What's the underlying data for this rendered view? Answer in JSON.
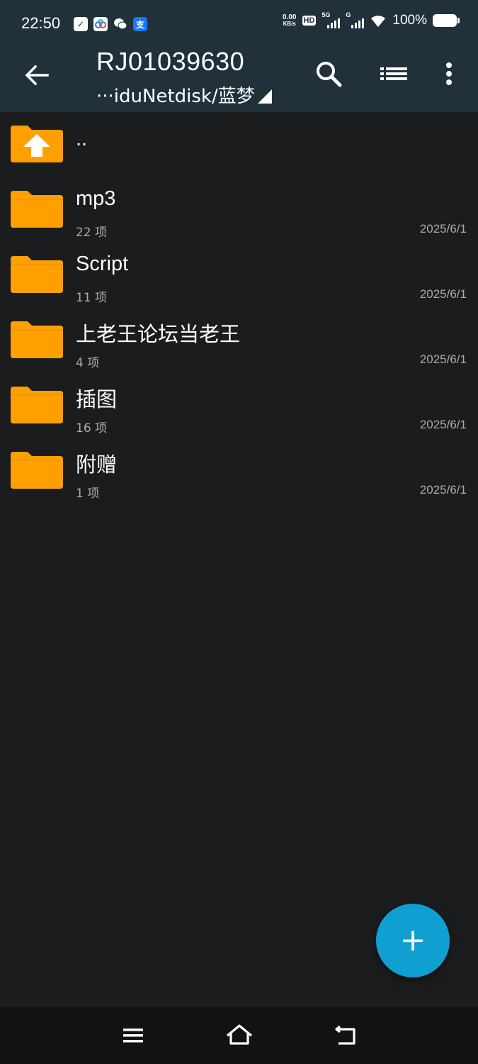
{
  "status_bar": {
    "time": "22:50",
    "net_speed_value": "0.00",
    "net_speed_unit": "KB/s",
    "hd_badge": "HD",
    "signal_label_1": "5G",
    "signal_label_2": "G",
    "battery": "100%",
    "app_icons": [
      "clipboard-check-icon",
      "baidu-netdisk-icon",
      "wechat-icon",
      "alipay-icon"
    ]
  },
  "app_bar": {
    "title": "RJ01039630",
    "path": "···iduNetdisk/蓝梦",
    "back_icon": "arrow-left-icon",
    "search_icon": "search-icon",
    "list_view_icon": "list-view-icon",
    "more_icon": "more-vert-icon"
  },
  "parent_item": {
    "name": "..",
    "icon": "folder-up-icon"
  },
  "folders": [
    {
      "name": "mp3",
      "count": "22 项",
      "date": "2025/6/1"
    },
    {
      "name": "Script",
      "count": "11 项",
      "date": "2025/6/1"
    },
    {
      "name": "上老王论坛当老王",
      "count": "4 项",
      "date": "2025/6/1"
    },
    {
      "name": "插图",
      "count": "16 项",
      "date": "2025/6/1"
    },
    {
      "name": "附赠",
      "count": "1 项",
      "date": "2025/6/1"
    }
  ],
  "fab": {
    "label": "+",
    "icon": "add-icon"
  },
  "nav_bar": {
    "icons": [
      "menu-icon",
      "home-icon",
      "back-return-icon"
    ]
  },
  "colors": {
    "app_bar": "#213039",
    "background": "#1b1c1e",
    "folder": "#ffa000",
    "fab": "#0f9fd0",
    "secondary_text": "#a9aaab",
    "nav_bar": "#111213"
  }
}
